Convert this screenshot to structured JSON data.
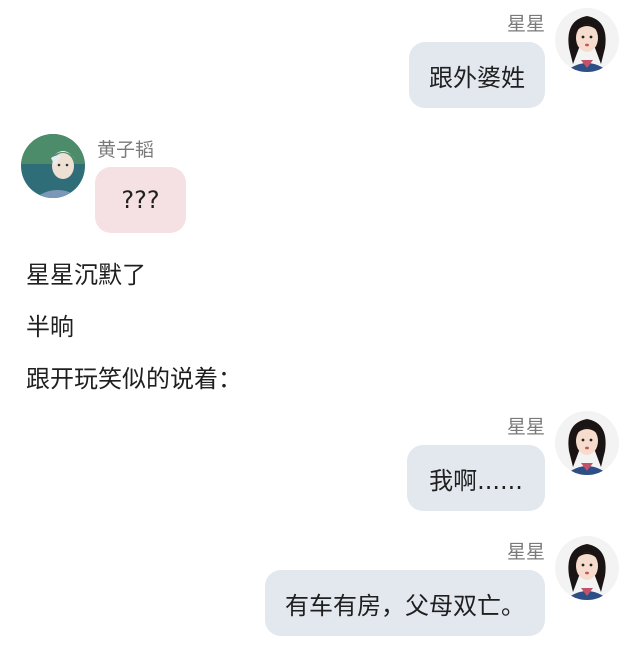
{
  "messages": [
    {
      "side": "right",
      "sender": "星星",
      "text": "跟外婆姓"
    },
    {
      "side": "left",
      "sender": "黄子韬",
      "text": "???"
    },
    {
      "side": "right",
      "sender": "星星",
      "text": "我啊......"
    },
    {
      "side": "right",
      "sender": "星星",
      "text": "有车有房，父母双亡。"
    }
  ],
  "narration": [
    "星星沉默了",
    "半晌",
    "跟开玩笑似的说着："
  ],
  "colors": {
    "right_bubble": "#e3e8ef",
    "left_bubble": "#f5e1e3",
    "sender_name": "#7a7a7a",
    "text": "#1f1f1f"
  },
  "icons": {
    "right_avatar": "girl-avatar-icon",
    "left_avatar": "boy-avatar-icon"
  }
}
